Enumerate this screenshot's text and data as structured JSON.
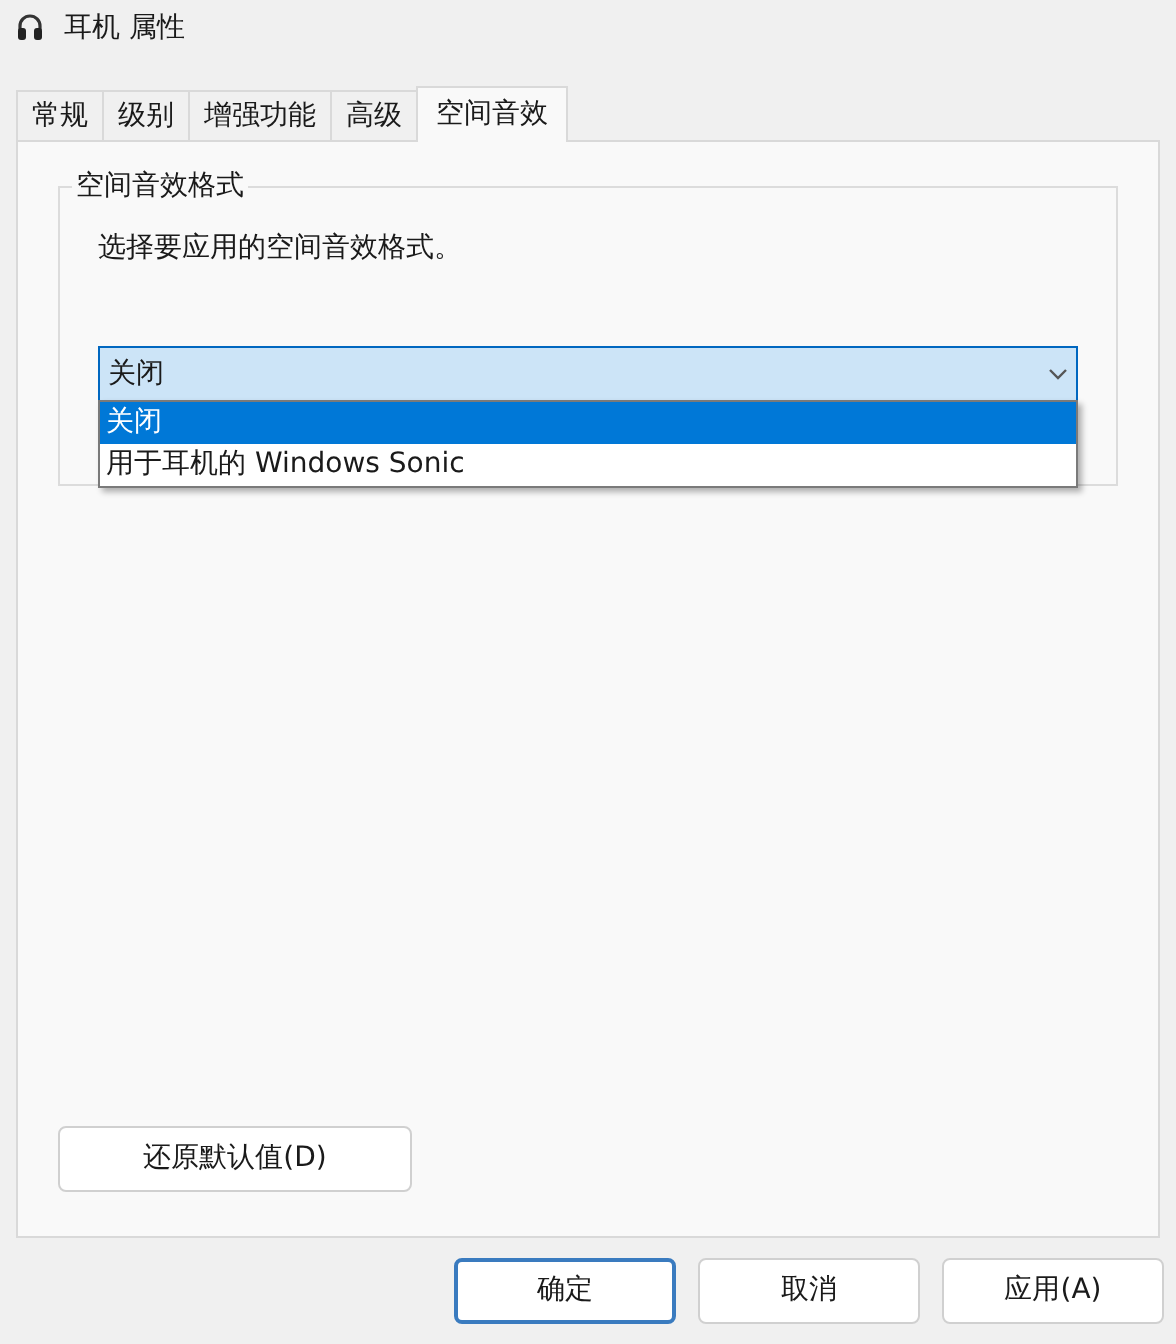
{
  "window": {
    "title": "耳机 属性"
  },
  "tabs": [
    {
      "label": "常规",
      "selected": false
    },
    {
      "label": "级别",
      "selected": false
    },
    {
      "label": "增强功能",
      "selected": false
    },
    {
      "label": "高级",
      "selected": false
    },
    {
      "label": "空间音效",
      "selected": true
    }
  ],
  "group": {
    "title": "空间音效格式",
    "description": "选择要应用的空间音效格式。",
    "dropdown": {
      "value": "关闭",
      "expanded": true,
      "options": [
        {
          "label": "关闭",
          "selected": true
        },
        {
          "label": "用于耳机的 Windows Sonic",
          "selected": false
        }
      ]
    }
  },
  "restore_button": "还原默认值(D)",
  "buttons": [
    {
      "label": "确定",
      "default": true
    },
    {
      "label": "取消",
      "default": false
    },
    {
      "label": "应用(A)",
      "default": false
    }
  ]
}
